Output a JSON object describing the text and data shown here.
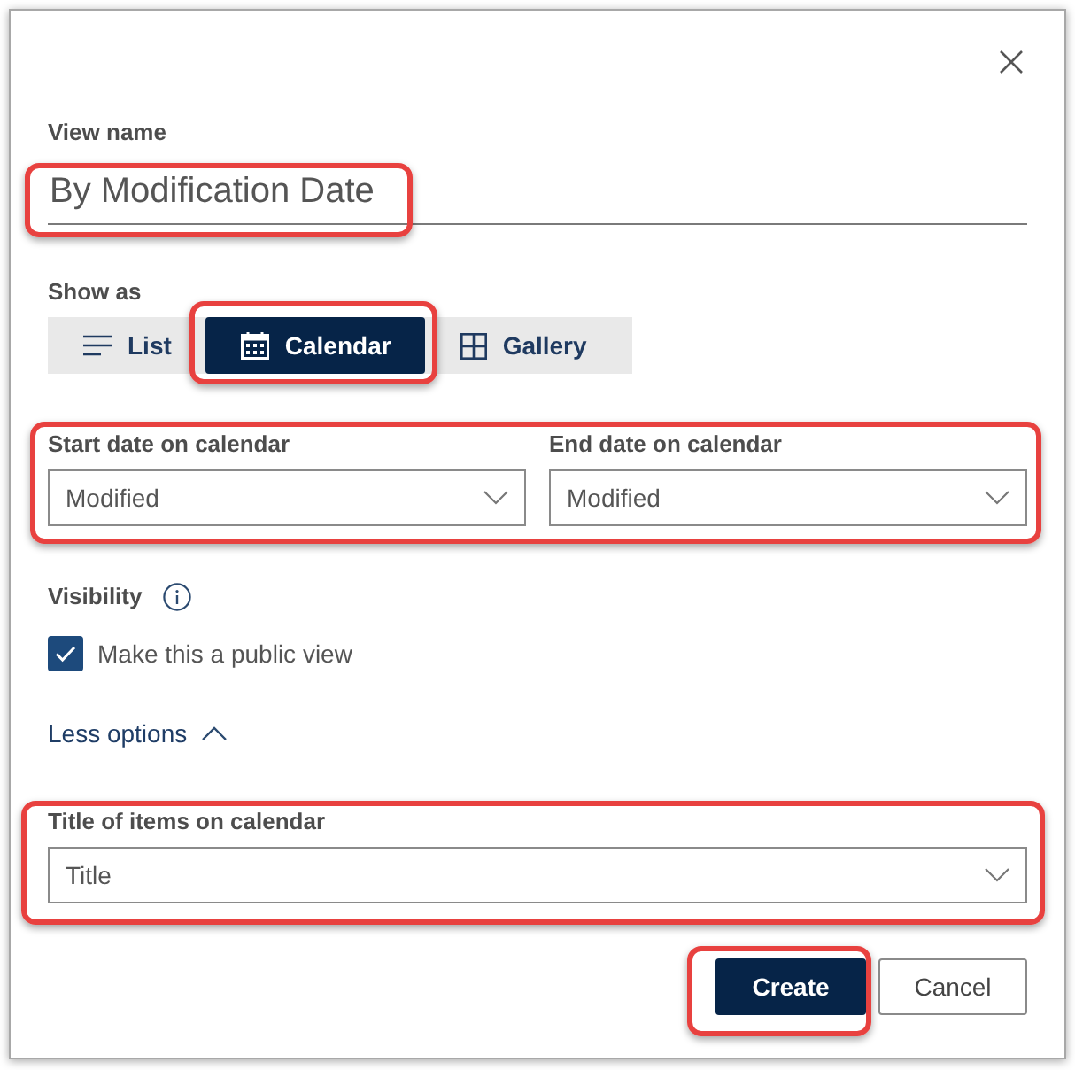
{
  "view_name": {
    "label": "View name",
    "value": "By Modification Date",
    "highlighted": true
  },
  "show_as": {
    "label": "Show as",
    "options": [
      {
        "label": "List",
        "kind": "list",
        "selected": false,
        "highlighted": false
      },
      {
        "label": "Calendar",
        "kind": "calendar",
        "selected": true,
        "highlighted": true
      },
      {
        "label": "Gallery",
        "kind": "gallery",
        "selected": false,
        "highlighted": false
      }
    ]
  },
  "date_fields": {
    "highlighted": true,
    "fields": [
      {
        "label": "Start date on calendar",
        "value": "Modified"
      },
      {
        "label": "End date on calendar",
        "value": "Modified"
      }
    ]
  },
  "visibility": {
    "label": "Visibility",
    "checkbox": {
      "label": "Make this a public view",
      "checked": true
    }
  },
  "options_toggle": {
    "label": "Less options",
    "expanded": true
  },
  "title_field": {
    "label": "Title of items on calendar",
    "value": "Title",
    "highlighted": true
  },
  "buttons": [
    {
      "label": "Create",
      "kind": "primary",
      "highlighted": true
    },
    {
      "label": "Cancel",
      "kind": "secondary",
      "highlighted": false
    }
  ]
}
